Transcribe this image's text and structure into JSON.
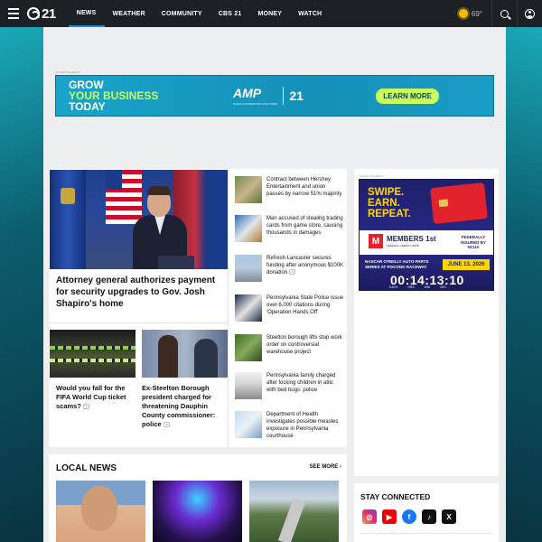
{
  "nav": {
    "logo_text": "21",
    "items": [
      {
        "label": "NEWS",
        "active": true
      },
      {
        "label": "WEATHER"
      },
      {
        "label": "COMMUNITY"
      },
      {
        "label": "CBS 21"
      },
      {
        "label": "MONEY"
      },
      {
        "label": "WATCH"
      }
    ],
    "temperature": "69°"
  },
  "banner_ad": {
    "label": "ADVERTISEMENT",
    "line1": "GROW",
    "line2": "YOUR BUSINESS",
    "line3": "TODAY",
    "brand": "AMP",
    "brand_sub": "SALES & MARKETING SOLUTIONS",
    "partner": "21",
    "cta": "LEARN MORE",
    "accent": "#c8ff5c"
  },
  "hero": {
    "title": "Attorney general authorizes payment for security upgrades to Gov. Josh Shapiro's home"
  },
  "small_stories": [
    {
      "title": "Would you fall for the FIFA World Cup ticket scams?",
      "video": true
    },
    {
      "title": "Ex-Steelton Borough president charged for threatening Dauphin County commissioner: police",
      "video": true
    }
  ],
  "side_stories": [
    {
      "title": "Contract between Hershey Entertainment and union passes by narrow 51% majority"
    },
    {
      "title": "Man accused of stealing trading cards from game store, causing thousands in damages"
    },
    {
      "title": "Refresh Lancaster secures funding after anonymous $100K donation",
      "video": true
    },
    {
      "title": "Pennsylvania State Police issue over 6,000 citations during 'Operation Hands Off'"
    },
    {
      "title": "Steelton borough lifts stop work order on controversial warehouse project"
    },
    {
      "title": "Pennsylvania family charged after locking children in attic with bed bugs: police"
    },
    {
      "title": "Department of Health investigates possible measles exposure in Pennsylvania courthouse"
    }
  ],
  "right_ad": {
    "label": "ADVERTISEMENT",
    "headline_1": "SWIPE.",
    "headline_2": "EARN.",
    "headline_3": "REPEAT.",
    "members_name": "MEMBERS 1st",
    "members_sub": "FEDERAL CREDIT UNION",
    "ncua": "FEDERALLY INSURED BY NCUA",
    "event": "NASCAR O'REILLY AUTO PARTS SERIES AT POCONO RACEWAY",
    "date": "JUNE 13, 2026",
    "countdown": "00:14:13:10",
    "count_labels": [
      "DAYS",
      "HRS",
      "MIN",
      "SEC"
    ]
  },
  "local_news": {
    "title": "LOCAL NEWS",
    "see_more": "SEE MORE"
  },
  "connect": {
    "title": "STAY CONNECTED",
    "socials": [
      {
        "icon": "instagram-icon",
        "glyph": "◎"
      },
      {
        "icon": "youtube-icon",
        "glyph": "▶"
      },
      {
        "icon": "facebook-icon",
        "glyph": "f"
      },
      {
        "icon": "tiktok-icon",
        "glyph": "♪"
      },
      {
        "icon": "x-icon",
        "glyph": "X"
      }
    ]
  }
}
